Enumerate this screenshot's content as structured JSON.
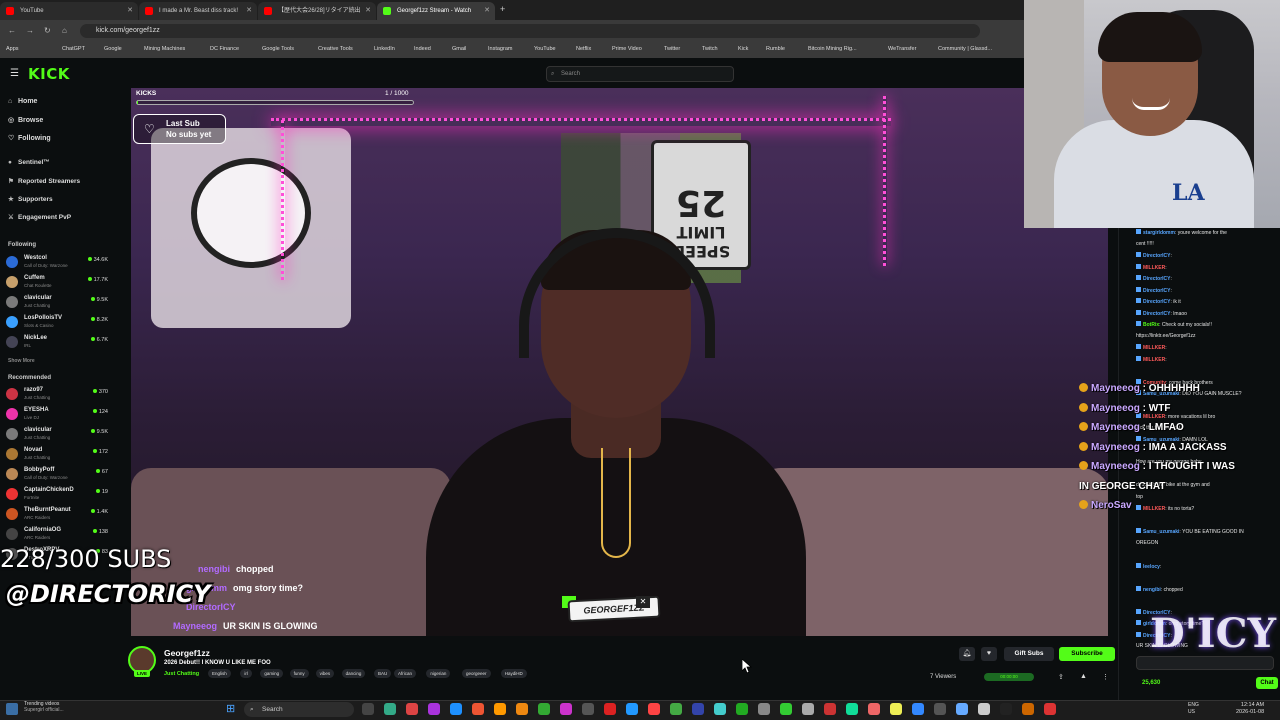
{
  "tabs": [
    {
      "title": "YouTube",
      "color": "#ff0000"
    },
    {
      "title": "I made a Mr. Beast diss track!",
      "color": "#ff0000"
    },
    {
      "title": "【歴代大会26/28]リタイア続出",
      "color": "#ff0000"
    },
    {
      "title": "Georgef1zz Stream - Watch",
      "color": "#53fc18"
    }
  ],
  "address": "kick.com/georgef1zz",
  "bookmarks": [
    "Apps",
    "ChatGPT",
    "Google",
    "Mining Machines",
    "DC Finance",
    "Google Tools",
    "Creative Tools",
    "LinkedIn",
    "Indeed",
    "Gmail",
    "Instagram",
    "YouTube",
    "Netflix",
    "Prime Video",
    "Twitter",
    "Twitch",
    "Kick",
    "Rumble",
    "Bitcoin Mining Rig...",
    "WeTransfer",
    "Community | Glassd..."
  ],
  "header": {
    "logo": "KICK",
    "search_placeholder": "Search"
  },
  "sidebar": {
    "nav": [
      {
        "label": "Home",
        "icon": "home-icon"
      },
      {
        "label": "Browse",
        "icon": "compass-icon"
      },
      {
        "label": "Following",
        "icon": "heart-icon"
      }
    ],
    "extensions": [
      "Sentinel™",
      "Reported Streamers",
      "Supporters",
      "Engagement PvP"
    ],
    "following_title": "Following",
    "following": [
      {
        "name": "Westcol",
        "cat": "Call of Duty: Warzone",
        "viewers": "34.6K",
        "color": "#2b6bd6"
      },
      {
        "name": "Cuffem",
        "cat": "Chat Roulette",
        "viewers": "17.7K",
        "color": "#c7a06b"
      },
      {
        "name": "clavicular",
        "cat": "Just Chatting",
        "viewers": "9.5K",
        "color": "#7a7a7a"
      },
      {
        "name": "LosPolloisTV",
        "cat": "Slots & Casino",
        "viewers": "8.2K",
        "color": "#3aa0ff"
      },
      {
        "name": "NickLee",
        "cat": "IRL",
        "viewers": "6.7K",
        "color": "#445"
      }
    ],
    "show_more": "Show More",
    "recommended_title": "Recommended",
    "recommended": [
      {
        "name": "razo97",
        "cat": "Just Chatting",
        "viewers": "370",
        "color": "#c34"
      },
      {
        "name": "EYESHA",
        "cat": "Live DJ",
        "viewers": "124",
        "color": "#e3a"
      },
      {
        "name": "clavicular",
        "cat": "Just Chatting",
        "viewers": "9.5K",
        "color": "#7a7a7a"
      },
      {
        "name": "Novad",
        "cat": "Just Chatting",
        "viewers": "172",
        "color": "#a73"
      },
      {
        "name": "BobbyPoff",
        "cat": "Call of Duty: Warzone",
        "viewers": "67",
        "color": "#b85"
      },
      {
        "name": "CaptainChickenD",
        "cat": "Fortnite",
        "viewers": "19",
        "color": "#e33"
      },
      {
        "name": "TheBurntPeanut",
        "cat": "ARC Raiders",
        "viewers": "1.4K",
        "color": "#c52"
      },
      {
        "name": "CaliforniaOG",
        "cat": "ARC Raiders",
        "viewers": "138",
        "color": "#444"
      },
      {
        "name": "DestroXRPV",
        "cat": "V Tubers",
        "viewers": "83",
        "color": "#555"
      }
    ]
  },
  "video": {
    "kicks_label": "KICKS",
    "kicks_count": "1 / 1000",
    "kicks_progress": 0.001,
    "last_sub_title": "Last Sub",
    "last_sub_value": "No subs yet",
    "corner_text": "SU",
    "sign_line1": "SPEED",
    "sign_line2": "LIMIT",
    "sign_line3": "25",
    "overlay_chat": [
      {
        "user": "nengibi",
        "msg": "chopped"
      },
      {
        "user": "girldomm",
        "msg": "omg story time?"
      },
      {
        "user": "DirectorICY",
        "msg": ""
      },
      {
        "user": "Mayneeog",
        "msg": "UR SKIN IS GLOWING"
      }
    ],
    "subs_goal": "228/300 SUBS",
    "handle": "@DIRECTORICY",
    "watermark": "GEORGEF1ZZ"
  },
  "stream": {
    "name": "Georgef1zz",
    "title": "2026 Debut!! I KNOW U LIKE ME FOO",
    "category": "Just Chatting",
    "live": "LIVE",
    "tags": [
      "English",
      "irl",
      "gaming",
      "funny",
      "vibes",
      "dancing",
      "BAU",
      "African",
      "nigerian",
      "georgeeer",
      "HaydiHD"
    ],
    "viewers": "7 Viewers",
    "uptime": "00:00:00",
    "gift_label": "Gift Subs",
    "subscribe_label": "Subscribe"
  },
  "chat": {
    "messages": [
      {
        "user": "stargirldomm",
        "msg": "youre welcome for the",
        "cls": "b"
      },
      {
        "user": "",
        "msg": "cent !!!!!",
        "cls": ""
      },
      {
        "user": "DirectorICY",
        "msg": "",
        "cls": "b"
      },
      {
        "user": "MILLKER",
        "msg": "",
        "cls": "r"
      },
      {
        "user": "DirectorICY",
        "msg": "",
        "cls": "b"
      },
      {
        "user": "DirectorICY",
        "msg": "",
        "cls": "b"
      },
      {
        "user": "DirectorICY",
        "msg": "ik it",
        "cls": "b"
      },
      {
        "user": "DirectorICY",
        "msg": "lmaoo",
        "cls": "b"
      },
      {
        "user": "BotRix",
        "msg": "Check out my socials!!",
        "cls": "g"
      },
      {
        "user": "",
        "msg": "https://linktr.ee/Georgef1zz",
        "cls": ""
      },
      {
        "user": "MILLKER",
        "msg": "",
        "cls": "r"
      },
      {
        "user": "MILLKER",
        "msg": "",
        "cls": "r"
      },
      {
        "user": "",
        "msg": "",
        "cls": ""
      },
      {
        "user": "Comunity",
        "msg": "come back brothers",
        "cls": "r"
      },
      {
        "user": "Samu_uzumaki",
        "msg": "DID YOU GAIN MUSCLE?",
        "cls": "b"
      },
      {
        "user": "",
        "msg": "",
        "cls": ""
      },
      {
        "user": "MILLKER",
        "msg": "more vacations lil bro",
        "cls": "r"
      },
      {
        "user": "",
        "msg": "lock the fuck in mud",
        "cls": ""
      },
      {
        "user": "Samu_uzumaki",
        "msg": "DAMN LOL",
        "cls": "b"
      },
      {
        "user": "",
        "msg": "",
        "cls": ""
      },
      {
        "user": "",
        "msg": "How are you my george baby",
        "cls": ""
      },
      {
        "user": "",
        "msg": "",
        "cls": ""
      },
      {
        "user": "",
        "msg": "dude hits the bike at the gym and",
        "cls": ""
      },
      {
        "user": "",
        "msg": "top",
        "cls": ""
      },
      {
        "user": "MILLKER",
        "msg": "its no torta?",
        "cls": "r"
      },
      {
        "user": "",
        "msg": "",
        "cls": ""
      },
      {
        "user": "Samu_uzumaki",
        "msg": "YOU BE EATING GOOD IN",
        "cls": "b"
      },
      {
        "user": "",
        "msg": "OREGON",
        "cls": ""
      },
      {
        "user": "",
        "msg": "",
        "cls": ""
      },
      {
        "user": "leelocy",
        "msg": "",
        "cls": "b"
      },
      {
        "user": "",
        "msg": "",
        "cls": ""
      },
      {
        "user": "nengibi",
        "msg": "chopped",
        "cls": "b"
      },
      {
        "user": "",
        "msg": "",
        "cls": ""
      },
      {
        "user": "DirectorICY",
        "msg": "",
        "cls": "b"
      },
      {
        "user": "girldomm",
        "msg": "omg story time?",
        "cls": "b"
      },
      {
        "user": "DirectorICY",
        "msg": "",
        "cls": "b"
      },
      {
        "user": "",
        "msg": "UR SKIN IS GLOWING",
        "cls": ""
      }
    ],
    "overlay": [
      {
        "user": "Mayneeog",
        "msg": "OHHHHHH"
      },
      {
        "user": "Mayneeog",
        "msg": "WTF"
      },
      {
        "user": "Mayneeog",
        "msg": "LMFAO"
      },
      {
        "user": "Mayneeog",
        "msg": "IMA A JACKASS"
      },
      {
        "user": "Mayneeog",
        "msg": "I THOUGHT I WAS"
      },
      {
        "user": "",
        "msg": "IN GEORGE CHAT"
      },
      {
        "user": "NeroSav",
        "msg": ""
      }
    ],
    "balance": "25,630",
    "chat_button": "Chat"
  },
  "brand": "D'ICY",
  "taskbar": {
    "news_line1": "Trending videos",
    "news_line2": "Supergirl official...",
    "search": "Search",
    "tray1": "ENG",
    "tray2": "US",
    "time": "12:14 AM",
    "date": "2026-01-08"
  }
}
